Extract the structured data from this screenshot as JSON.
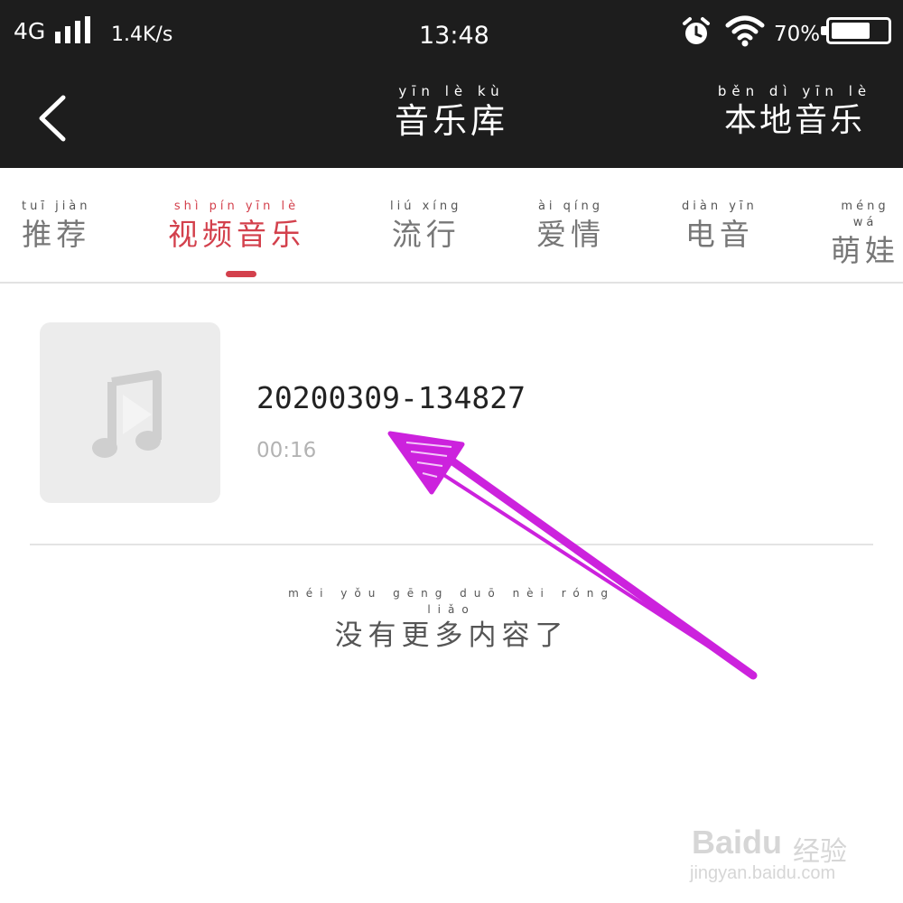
{
  "status_bar": {
    "network": "4G",
    "speed": "1.4K/s",
    "time": "13:48",
    "battery_percent": "70%",
    "battery_level": 0.7,
    "icons": [
      "signal-icon",
      "alarm-icon",
      "wifi-icon",
      "battery-icon"
    ]
  },
  "header": {
    "title": "音乐库",
    "title_pinyin": "yīn lè kù",
    "right_action": "本地音乐",
    "right_action_pinyin": "běn dì yīn lè",
    "back_icon": "chevron-left-icon"
  },
  "tabs": [
    {
      "label": "推荐",
      "pinyin": "tuī jiàn",
      "active": false
    },
    {
      "label": "视频音乐",
      "pinyin": "shì pín yīn lè",
      "active": true
    },
    {
      "label": "流行",
      "pinyin": "liú xíng",
      "active": false
    },
    {
      "label": "爱情",
      "pinyin": "ài qíng",
      "active": false
    },
    {
      "label": "电音",
      "pinyin": "diàn yīn",
      "active": false
    },
    {
      "label": "萌娃",
      "pinyin": "méng wá",
      "active": false
    }
  ],
  "songs": [
    {
      "title": "20200309-134827",
      "duration": "00:16",
      "cover_icon": "music-play-icon"
    }
  ],
  "end_note": {
    "text": "没有更多内容了",
    "pinyin": "méi yǒu gēng duō nèi róng liǎo"
  },
  "annotation": {
    "color": "#cc22dd"
  },
  "watermark": {
    "brand": "Baidu",
    "brand_cn": "经验",
    "url": "jingyan.baidu.com"
  },
  "colors": {
    "accent": "#d3404c",
    "header_bg": "#1d1d1d"
  }
}
